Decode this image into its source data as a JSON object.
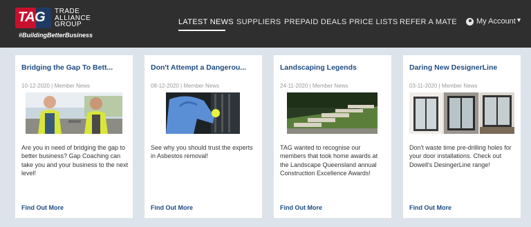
{
  "logo": {
    "badge": "TAG",
    "name": "TRADE ALLIANCE GROUP",
    "tagline": "#BuildingBetterBusiness"
  },
  "nav": {
    "items": [
      "LATEST NEWS",
      "SUPPLIERS",
      "PREPAID DEALS",
      "PRICE LISTS",
      "REFER A MATE"
    ],
    "active": "LATEST NEWS",
    "account_label": "My Account"
  },
  "cards": [
    {
      "title": "Bridging the Gap To Bett...",
      "date": "10-12-2020",
      "category": "Member News",
      "meta": "10-12-2020 | Member News",
      "text": "Are you in need of bridging the gap to better business? Gap Coaching can take you and your business to the next level!",
      "link": "Find Out More"
    },
    {
      "title": "Don't Attempt a Dangerou...",
      "date": "08-12-2020",
      "category": "Member News",
      "meta": "08-12-2020 | Member News",
      "text": "See why you should trust the experts in Asbestos removal!",
      "link": "Find Out More"
    },
    {
      "title": "Landscaping Legends",
      "date": "24-11-2020",
      "category": "Member News",
      "meta": "24-11-2020 | Member News",
      "text": "TAG wanted to recognise our members that took home awards at the Landscape Queensland annual Construction Excellence Awards!",
      "link": "Find Out More"
    },
    {
      "title": "Daring New DesignerLine",
      "date": "03-11-2020",
      "category": "Member News",
      "meta": "03-11-2020 | Member News",
      "text": "Don't waste time pre-drilling holes for your door installations. Check out Dowell's DesingerLine range!",
      "link": "Find Out More"
    }
  ],
  "colors": {
    "header_bg": "#2f2f2f",
    "page_bg": "#dde3ea",
    "title_blue": "#1d4b82",
    "brand_red": "#c8102e"
  }
}
